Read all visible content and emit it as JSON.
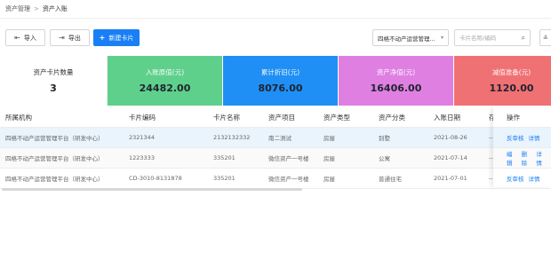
{
  "breadcrumb": {
    "parent": "资产管理",
    "separator": ">",
    "current": "资产入账"
  },
  "toolbar": {
    "import_label": "导入",
    "export_label": "导出",
    "new_card_label": "新建卡片",
    "org_select_value": "四格不动产运营管理...",
    "search_placeholder": "卡片名称/编码"
  },
  "stats": [
    {
      "label": "资产卡片数量",
      "value": "3",
      "color": "#ffffff"
    },
    {
      "label": "入账原值(元)",
      "value": "24482.00",
      "color": "#5fd08b"
    },
    {
      "label": "累计折旧(元)",
      "value": "8076.00",
      "color": "#1f8ff5"
    },
    {
      "label": "资产净值(元)",
      "value": "16406.00",
      "color": "#df7fe2"
    },
    {
      "label": "减值准备(元)",
      "value": "1120.00",
      "color": "#f07173"
    }
  ],
  "table": {
    "columns": [
      "所属机构",
      "卡片编码",
      "卡片名称",
      "资产项目",
      "资产类型",
      "资产分类",
      "入账日期",
      "存",
      "操作"
    ],
    "rows": [
      {
        "org": "四格不动产运营管理平台（研发中心）",
        "code": "2321344",
        "name": "2132132332",
        "project": "南二测试",
        "type": "房屋",
        "category": "别墅",
        "date": "2021-08-26",
        "extra": "--",
        "actions": [
          "反审核",
          "详情"
        ]
      },
      {
        "org": "四格不动产运营管理平台（研发中心）",
        "code": "1223333",
        "name": "335201",
        "project": "微信资产一号楼",
        "type": "房屋",
        "category": "公寓",
        "date": "2021-07-14",
        "extra": "--",
        "actions": [
          "编辑",
          "删除",
          "详情"
        ]
      },
      {
        "org": "四格不动产运营管理平台（研发中心）",
        "code": "CD-3010-8131878",
        "name": "335201",
        "project": "微信资产一号楼",
        "type": "房屋",
        "category": "普通住宅",
        "date": "2021-07-01",
        "extra": "--",
        "actions": [
          "反审核",
          "详情"
        ]
      }
    ]
  },
  "icons": {
    "import": "import-icon",
    "export": "export-icon",
    "add": "plus-icon",
    "dropdown": "chevron-down-icon",
    "search": "search-icon",
    "collapse": "collapse-icon"
  },
  "colors": {
    "primary": "#1a7ff5",
    "row_highlight": "#eaf4fc"
  }
}
